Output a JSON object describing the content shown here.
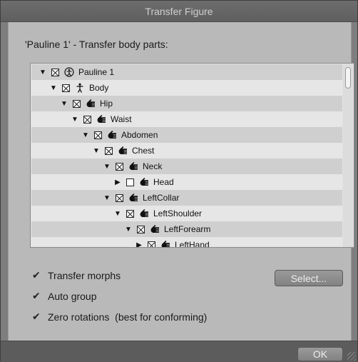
{
  "window": {
    "title": "Transfer Figure"
  },
  "heading": "'Pauline 1' - Transfer body parts:",
  "tree": {
    "rows": [
      {
        "label": "Pauline 1",
        "indent": 0,
        "expanded": true,
        "checked": true,
        "icon": "figure-icon"
      },
      {
        "label": "Body",
        "indent": 1,
        "expanded": true,
        "checked": true,
        "icon": "body-icon"
      },
      {
        "label": "Hip",
        "indent": 2,
        "expanded": true,
        "checked": true,
        "icon": "hand-icon"
      },
      {
        "label": "Waist",
        "indent": 3,
        "expanded": true,
        "checked": true,
        "icon": "hand-icon"
      },
      {
        "label": "Abdomen",
        "indent": 4,
        "expanded": true,
        "checked": true,
        "icon": "hand-icon"
      },
      {
        "label": "Chest",
        "indent": 5,
        "expanded": true,
        "checked": true,
        "icon": "hand-icon"
      },
      {
        "label": "Neck",
        "indent": 6,
        "expanded": true,
        "checked": true,
        "icon": "hand-icon"
      },
      {
        "label": "Head",
        "indent": 7,
        "expanded": false,
        "checked": false,
        "icon": "hand-icon"
      },
      {
        "label": "LeftCollar",
        "indent": 6,
        "expanded": true,
        "checked": true,
        "icon": "hand-icon"
      },
      {
        "label": "LeftShoulder",
        "indent": 7,
        "expanded": true,
        "checked": true,
        "icon": "hand-icon"
      },
      {
        "label": "LeftForearm",
        "indent": 8,
        "expanded": true,
        "checked": true,
        "icon": "hand-icon"
      },
      {
        "label": "LeftHand",
        "indent": 9,
        "expanded": false,
        "checked": true,
        "icon": "hand-icon"
      }
    ]
  },
  "options": {
    "transfer_morphs": {
      "label": "Transfer morphs",
      "checked": true
    },
    "auto_group": {
      "label": "Auto group",
      "checked": true
    },
    "zero_rotations": {
      "label": "Zero rotations  (best for conforming)",
      "checked": true
    }
  },
  "buttons": {
    "select_label": "Select...",
    "ok_label": "OK"
  },
  "glyphs": {
    "tick": "✔",
    "expanded": "▼",
    "collapsed": "▶"
  }
}
